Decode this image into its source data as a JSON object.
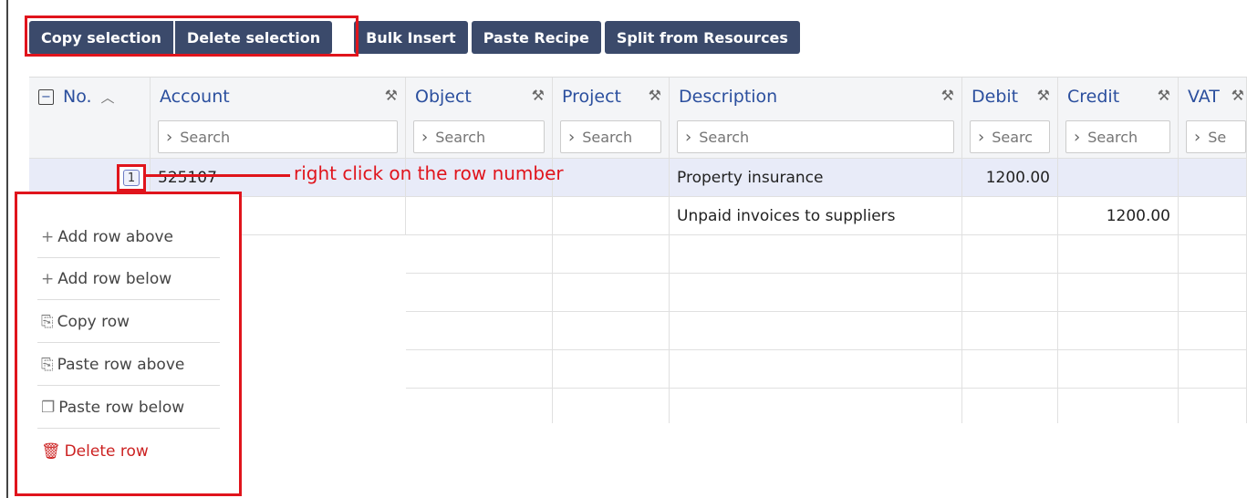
{
  "toolbar": {
    "copy_selection": "Copy selection",
    "delete_selection": "Delete selection",
    "bulk_insert": "Bulk Insert",
    "paste_recipe": "Paste Recipe",
    "split_from_resources": "Split from Resources"
  },
  "columns": {
    "no": "No.",
    "account": "Account",
    "object": "Object",
    "project": "Project",
    "description": "Description",
    "debit": "Debit",
    "credit": "Credit",
    "vat": "VAT"
  },
  "search": {
    "placeholder": "Search",
    "debit_placeholder": "Searc",
    "vat_placeholder": "Se"
  },
  "rows": [
    {
      "no": "1",
      "account": "525107",
      "description": "Property insurance",
      "debit": "1200.00",
      "credit": ""
    },
    {
      "no": "",
      "account": "",
      "description": "Unpaid invoices to suppliers",
      "debit": "",
      "credit": "1200.00"
    }
  ],
  "annotation": "right click on the row number",
  "context_menu": {
    "add_row_above": "Add row above",
    "add_row_below": "Add row below",
    "copy_row": "Copy row",
    "paste_row_above": "Paste row above",
    "paste_row_below": "Paste row below",
    "delete_row": "Delete row"
  },
  "icons": {
    "plus": "plus-icon",
    "copy": "copy-icon",
    "paste": "paste-icon",
    "trash": "trash-icon",
    "wrench": "wrench-icon",
    "sort": "sort-ascending-icon",
    "chevron": "chevron-right-icon"
  },
  "colors": {
    "toolbar_button": "#3b4a6b",
    "highlight": "#e0141c",
    "header_text": "#2b4f9e",
    "selected_row": "#e8ebf8",
    "danger": "#cc2222"
  }
}
